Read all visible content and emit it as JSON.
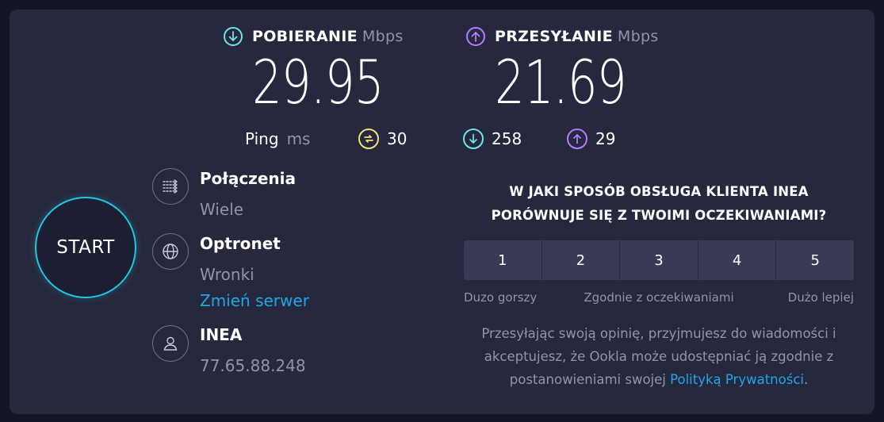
{
  "download": {
    "label": "POBIERANIE",
    "unit": "Mbps",
    "value": "29.95",
    "icon": "arrow-down-circle-icon"
  },
  "upload": {
    "label": "PRZESYŁANIE",
    "unit": "Mbps",
    "value": "21.69",
    "icon": "arrow-up-circle-icon"
  },
  "ping": {
    "label": "Ping",
    "unit": "ms",
    "idle": "30",
    "download_latency": "258",
    "upload_latency": "29"
  },
  "start_button": {
    "label": "START"
  },
  "connections": {
    "title": "Połączenia",
    "value": "Wiele"
  },
  "server": {
    "title": "Optronet",
    "location": "Wronki",
    "change_link": "Zmień serwer"
  },
  "provider": {
    "title": "INEA",
    "ip": "77.65.88.248"
  },
  "survey": {
    "question_line1": "W JAKI SPOSÓB OBSŁUGA KLIENTA INEA",
    "question_line2": "PORÓWNUJE SIĘ Z TWOIMI OCZEKIWANIAMI?",
    "options": [
      "1",
      "2",
      "3",
      "4",
      "5"
    ],
    "label_low": "Duzo gorszy",
    "label_mid": "Zgodnie z oczekiwaniami",
    "label_high": "Dużo lepiej",
    "disclaimer_before": "Przesyłając swoją opinię, przyjmujesz do wiadomości i akceptujesz, że Ookla może udostępniać ją zgodnie z postanowieniami swojej ",
    "privacy_link": "Polityką Prywatności",
    "disclaimer_after": "."
  },
  "colors": {
    "background": "#141526",
    "panel": "#26283d",
    "download_accent": "#6ee6e6",
    "upload_accent": "#b57bff",
    "ping_accent": "#f2e27a",
    "start_ring": "#1fc8e0",
    "link": "#1fa5e6",
    "muted": "#9193a8"
  }
}
